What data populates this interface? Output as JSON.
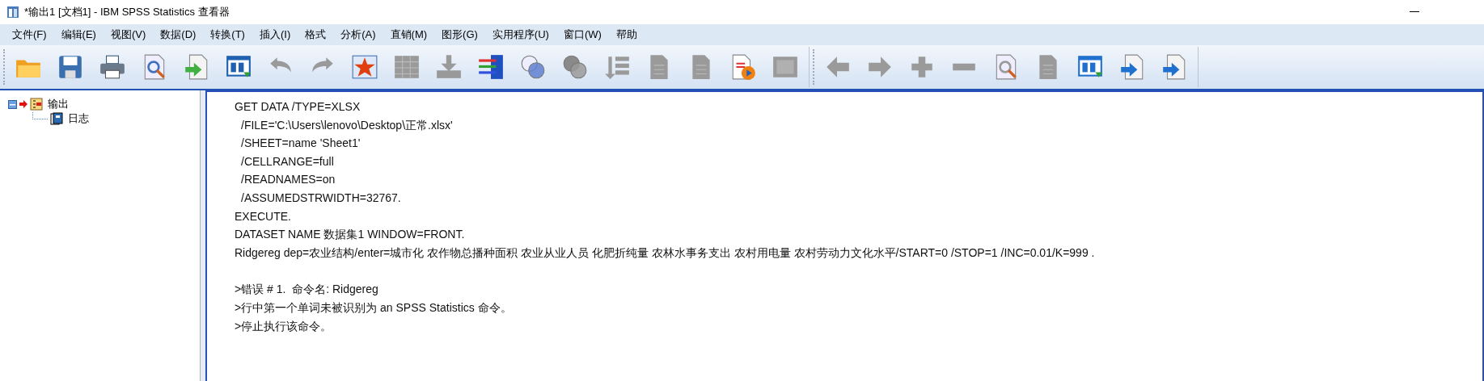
{
  "window": {
    "title": "*输出1 [文档1] - IBM SPSS Statistics 查看器"
  },
  "menu": [
    "文件(F)",
    "编辑(E)",
    "视图(V)",
    "数据(D)",
    "转换(T)",
    "插入(I)",
    "格式",
    "分析(A)",
    "直销(M)",
    "图形(G)",
    "实用程序(U)",
    "窗口(W)",
    "帮助"
  ],
  "toolbar": {
    "groups": [
      [
        {
          "disabled": false
        },
        {
          "disabled": false
        },
        {
          "disabled": false
        },
        {
          "disabled": false
        },
        {
          "disabled": false
        },
        {
          "disabled": false
        },
        {
          "disabled": true
        },
        {
          "disabled": true
        },
        {
          "disabled": false
        },
        {
          "disabled": true
        },
        {
          "disabled": true
        },
        {
          "disabled": false
        },
        {
          "disabled": false
        },
        {
          "disabled": true
        },
        {
          "disabled": true
        },
        {
          "disabled": true
        },
        {
          "disabled": true
        },
        {
          "disabled": false
        },
        {
          "disabled": true
        }
      ],
      [
        {
          "disabled": true
        },
        {
          "disabled": true
        },
        {
          "disabled": true
        },
        {
          "disabled": true
        },
        {
          "disabled": true
        },
        {
          "disabled": true
        },
        {
          "disabled": false
        },
        {
          "disabled": false
        },
        {
          "disabled": false
        }
      ]
    ]
  },
  "tree": {
    "label": "输出",
    "expanded": true,
    "children": [
      {
        "label": "日志"
      }
    ]
  },
  "log": [
    {
      "lines": [
        {
          "text": "GET DATA /TYPE=XLSX",
          "indented": false
        },
        {
          "text": "/FILE='C:\\Users\\lenovo\\Desktop\\正常.xlsx'",
          "indented": true
        },
        {
          "text": "/SHEET=name 'Sheet1'",
          "indented": true
        },
        {
          "text": "/CELLRANGE=full",
          "indented": true
        },
        {
          "text": "/READNAMES=on",
          "indented": true
        },
        {
          "text": "/ASSUMEDSTRWIDTH=32767.",
          "indented": true
        },
        {
          "text": "EXECUTE.",
          "indented": false
        },
        {
          "text": "DATASET NAME 数据集1 WINDOW=FRONT.",
          "indented": false
        },
        {
          "text": "Ridgereg dep=农业结构/enter=城市化 农作物总播种面积 农业从业人员 化肥折纯量 农林水事务支出 农村用电量 农村劳动力文化水平/START=0 /STOP=1 /INC=0.01/K=999 .",
          "indented": false
        }
      ]
    },
    {
      "lines": [
        {
          "text": ">错误 # 1.  命令名: Ridgereg",
          "indented": false
        },
        {
          "text": ">行中第一个单词未被识别为 an SPSS Statistics 命令。",
          "indented": false
        },
        {
          "text": ">停止执行该命令。",
          "indented": false
        }
      ]
    }
  ]
}
